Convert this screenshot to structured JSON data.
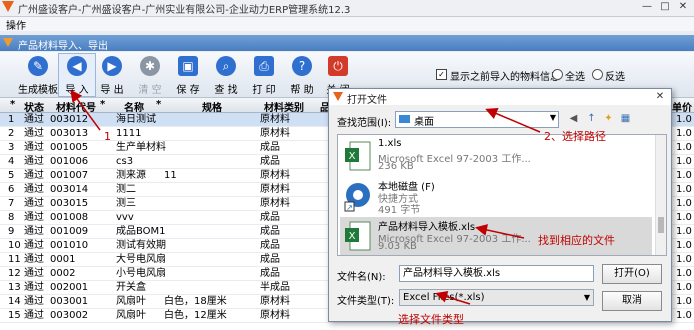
{
  "window": {
    "title": "广州盛设客户-广州盛设客户-广州实业有限公司-企业动力ERP管理系统12.3",
    "minimize": "—",
    "maximize": "□",
    "close": "✕"
  },
  "menu": {
    "operate": "操作"
  },
  "inner_window": {
    "title": "产品材料导入、导出"
  },
  "toolbar": {
    "buttons": [
      {
        "label": "生成模板",
        "icon": "pencil-icon",
        "color": "#2f6fcf"
      },
      {
        "label": "导 入",
        "icon": "arrow-left-icon",
        "color": "#2f6fcf"
      },
      {
        "label": "导 出",
        "icon": "arrow-right-icon",
        "color": "#2f6fcf"
      },
      {
        "label": "清 空",
        "icon": "broom-icon",
        "color": "#8a96a3"
      },
      {
        "label": "删 除",
        "icon": "delete-icon",
        "color": "#8a96a3"
      },
      {
        "label": "保 存",
        "icon": "save-icon",
        "color": "#2f6fcf"
      },
      {
        "label": "查 找",
        "icon": "search-icon",
        "color": "#2f6fcf"
      },
      {
        "label": "打 印",
        "icon": "print-icon",
        "color": "#2f6fcf"
      },
      {
        "label": "帮 助",
        "icon": "help-icon",
        "color": "#2f6fcf"
      },
      {
        "label": "关 闭",
        "icon": "close-icon",
        "color": "#d23a2a"
      }
    ],
    "show_previous_label": "显示之前导入的物料信息",
    "select_all_label": "全选",
    "invert_label": "反选"
  },
  "grid": {
    "columns": [
      "*",
      "状态",
      "材料代号",
      "*",
      "名称",
      "*",
      "规格",
      "材料类别",
      "品",
      "单价"
    ],
    "rows": [
      [
        "1",
        "通过",
        "003012",
        "海日测试",
        "",
        "原材料"
      ],
      [
        "2",
        "通过",
        "003013",
        "1111",
        "",
        "原材料"
      ],
      [
        "3",
        "通过",
        "001005",
        "生产单材料頭",
        "",
        "成品"
      ],
      [
        "4",
        "通过",
        "001006",
        "cs3",
        "",
        "成品"
      ],
      [
        "5",
        "通过",
        "001007",
        "测来源",
        "11",
        "原材料"
      ],
      [
        "6",
        "通过",
        "003014",
        "测二",
        "",
        "原材料"
      ],
      [
        "7",
        "通过",
        "003015",
        "测三",
        "",
        "原材料"
      ],
      [
        "8",
        "通过",
        "001008",
        "vvv",
        "",
        "成品"
      ],
      [
        "9",
        "通过",
        "001009",
        "成品BOM1",
        "",
        "成品"
      ],
      [
        "10",
        "通过",
        "001010",
        "测试有效期",
        "",
        "成品"
      ],
      [
        "11",
        "通过",
        "0001",
        "大号电风扇",
        "",
        "成品"
      ],
      [
        "12",
        "通过",
        "0002",
        "小号电风扇",
        "",
        "成品"
      ],
      [
        "13",
        "通过",
        "002001",
        "开关盒",
        "",
        "半成品"
      ],
      [
        "14",
        "通过",
        "003001",
        "风扇叶",
        "白色，18厘米",
        "原材料"
      ],
      [
        "15",
        "通过",
        "003002",
        "风扇叶",
        "白色，12厘米",
        "原材料"
      ]
    ],
    "right_values": [
      "1.0",
      "1.0",
      "1.0",
      "1.0",
      "1.0",
      "1.0",
      "1.0",
      "1.0",
      "1.0",
      "1.0",
      "1.0",
      "1.0",
      "1.0",
      "1.0",
      "1.0"
    ],
    "last_row_extra": "采购"
  },
  "dialog": {
    "title": "打开文件",
    "look_in_label": "查找范围(I):",
    "look_in_value": "桌面",
    "files": [
      {
        "name": "1.xls",
        "type": "Microsoft Excel 97-2003 工作...",
        "size": "236 KB",
        "icon": "excel-icon"
      },
      {
        "name": "本地磁盘 (F)",
        "type": "快捷方式",
        "size": "491 字节",
        "icon": "disk-shortcut-icon"
      },
      {
        "name": "产品材料导入模板.xls",
        "type": "Microsoft Excel 97-2003 工作...",
        "size": "9.03 KB",
        "icon": "excel-icon"
      }
    ],
    "filename_label": "文件名(N):",
    "filename_value": "产品材料导入模板.xls",
    "filetype_label": "文件类型(T):",
    "filetype_value": "Excel Files(*.xls)",
    "open_button": "打开(O)",
    "cancel_button": "取消"
  },
  "annotations": {
    "step1": "1",
    "step2": "2、选择路径",
    "find_file": "找到相应的文件",
    "select_type": "选择文件类型"
  },
  "colors": {
    "annotation": "#c00000",
    "selection": "#cfe0f5",
    "title_gradient": "#4a7ec0"
  }
}
